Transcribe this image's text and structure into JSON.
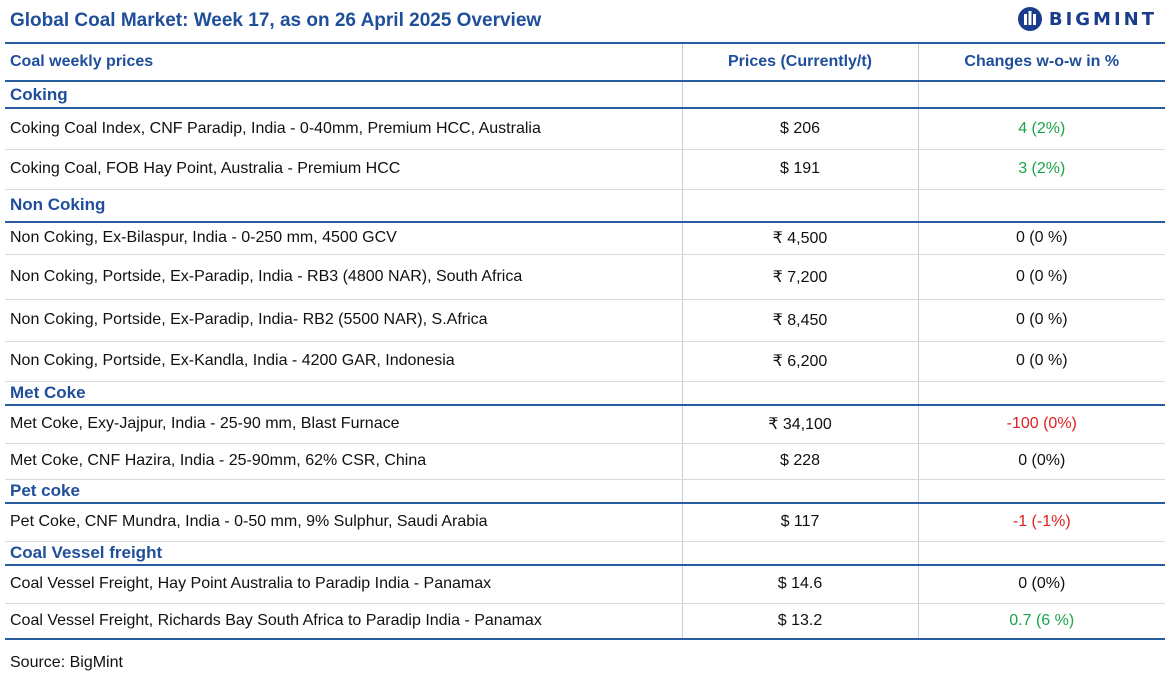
{
  "header": {
    "title": "Global Coal Market: Week 17, as on 26 April 2025 Overview",
    "logo_text": "BIGMINT"
  },
  "table": {
    "columns": [
      "Coal weekly prices",
      "Prices (Currently/t)",
      "Changes w-o-w in %"
    ],
    "groups": [
      {
        "category": "Coking",
        "rows": [
          {
            "name": "Coking Coal Index, CNF Paradip, India - 0-40mm, Premium HCC, Australia",
            "price": "$ 206",
            "change": "4 (2%)",
            "trend": "up"
          },
          {
            "name": "Coking Coal, FOB Hay Point, Australia - Premium HCC",
            "price": "$ 191",
            "change": "3 (2%)",
            "trend": "up"
          }
        ]
      },
      {
        "category": "Non Coking",
        "rows": [
          {
            "name": "Non Coking, Ex-Bilaspur, India - 0-250 mm, 4500 GCV",
            "price": "₹ 4,500",
            "change": "0 (0 %)",
            "trend": "flat"
          },
          {
            "name": "Non Coking, Portside, Ex-Paradip, India - RB3 (4800 NAR), South Africa",
            "price": "₹ 7,200",
            "change": "0 (0 %)",
            "trend": "flat"
          },
          {
            "name": "Non Coking, Portside, Ex-Paradip, India- RB2 (5500 NAR), S.Africa",
            "price": "₹ 8,450",
            "change": "0 (0 %)",
            "trend": "flat"
          },
          {
            "name": "Non Coking, Portside, Ex-Kandla, India - 4200 GAR, Indonesia",
            "price": "₹ 6,200",
            "change": "0 (0 %)",
            "trend": "flat"
          }
        ]
      },
      {
        "category": "Met Coke",
        "rows": [
          {
            "name": "Met Coke, Exy-Jajpur, India - 25-90 mm, Blast Furnace",
            "price": "₹ 34,100",
            "change": "-100 (0%)",
            "trend": "down"
          },
          {
            "name": "Met Coke, CNF Hazira, India - 25-90mm, 62% CSR, China",
            "price": "$ 228",
            "change": "0 (0%)",
            "trend": "flat"
          }
        ]
      },
      {
        "category": "Pet coke",
        "rows": [
          {
            "name": "Pet Coke, CNF Mundra, India - 0-50 mm, 9% Sulphur, Saudi Arabia",
            "price": "$ 117",
            "change": "-1 (-1%)",
            "trend": "down"
          }
        ]
      },
      {
        "category": "Coal Vessel freight",
        "rows": [
          {
            "name": "Coal Vessel Freight, Hay Point Australia to Paradip India - Panamax",
            "price": "$ 14.6",
            "change": "0 (0%)",
            "trend": "flat"
          },
          {
            "name": "Coal Vessel Freight, Richards Bay South Africa to Paradip India - Panamax",
            "price": "$ 13.2",
            "change": "0.7 (6 %)",
            "trend": "up"
          }
        ]
      }
    ]
  },
  "footer": {
    "source": "Source: BigMint"
  },
  "colors": {
    "brand_blue": "#1f4e9a",
    "up": "#1aa548",
    "down": "#e02020",
    "flat": "#111111"
  },
  "icons": {
    "logo": "bigmint-logo-icon"
  }
}
